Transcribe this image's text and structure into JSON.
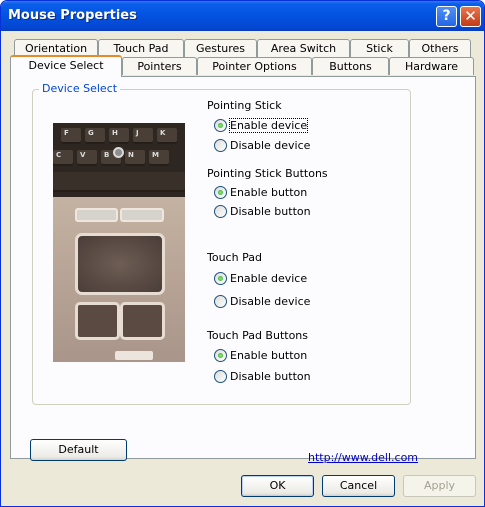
{
  "window": {
    "title": "Mouse Properties",
    "help_glyph": "?",
    "close_glyph": "✕"
  },
  "tabs_row1": [
    "Orientation",
    "Touch Pad",
    "Gestures",
    "Area Switch",
    "Stick",
    "Others"
  ],
  "tabs_row2": [
    "Device Select",
    "Pointers",
    "Pointer Options",
    "Buttons",
    "Hardware"
  ],
  "active_tab": "Device Select",
  "group": {
    "title": "Device Select"
  },
  "keys": [
    "F",
    "G",
    "H",
    "J",
    "K",
    "C",
    "V",
    "B",
    "N",
    "M"
  ],
  "pointing_stick": {
    "label": "Pointing Stick",
    "enable": "Enable device",
    "disable": "Disable device",
    "selected": "enable"
  },
  "pointing_stick_buttons": {
    "label": "Pointing Stick Buttons",
    "enable": "Enable button",
    "disable": "Disable button",
    "selected": "enable"
  },
  "touch_pad": {
    "label": "Touch Pad",
    "enable": "Enable device",
    "disable": "Disable device",
    "selected": "enable"
  },
  "touch_pad_buttons": {
    "label": "Touch Pad Buttons",
    "enable": "Enable button",
    "disable": "Disable button",
    "selected": "enable"
  },
  "default_button": "Default",
  "link": "http://www.dell.com",
  "footer": {
    "ok": "OK",
    "cancel": "Cancel",
    "apply": "Apply"
  }
}
